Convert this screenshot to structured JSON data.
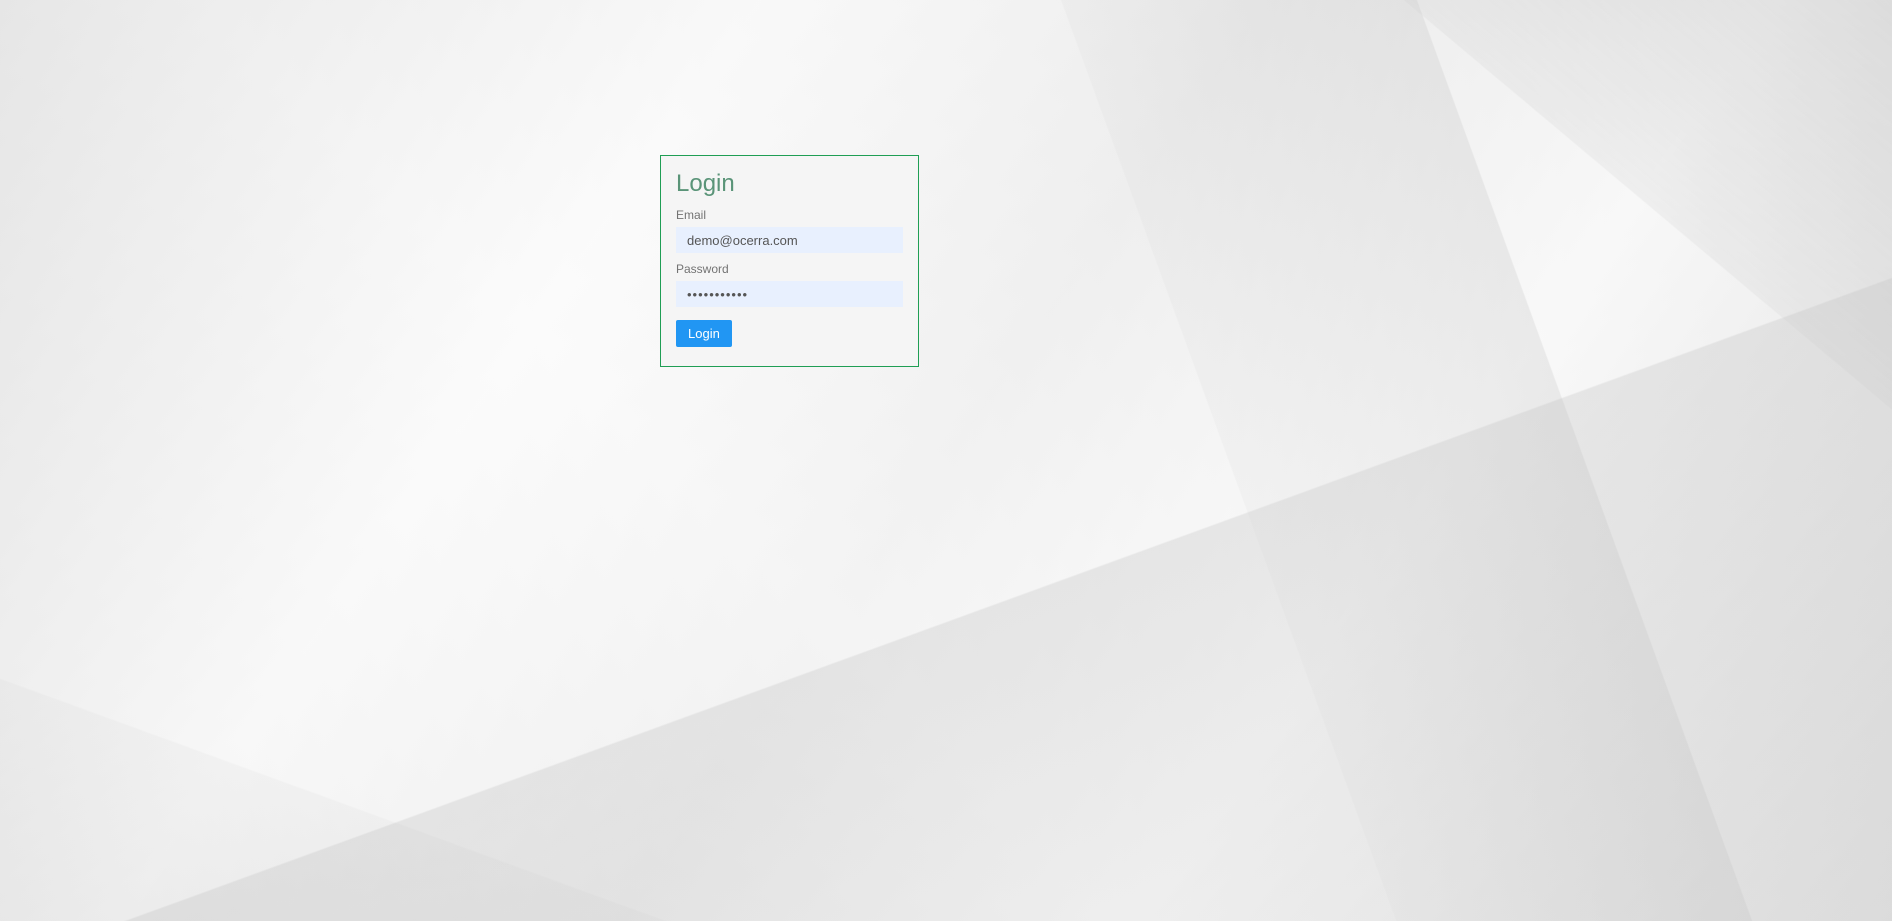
{
  "login": {
    "title": "Login",
    "email_label": "Email",
    "email_value": "demo@ocerra.com",
    "password_label": "Password",
    "password_value": "•••••••••••",
    "button_label": "Login"
  }
}
